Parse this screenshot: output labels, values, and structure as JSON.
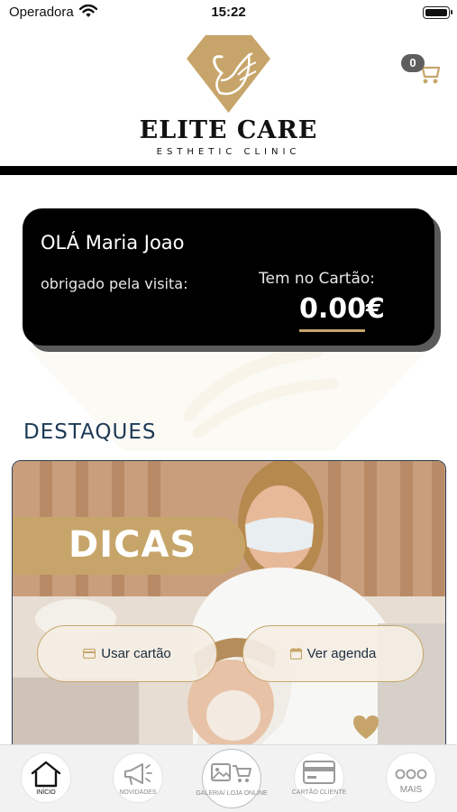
{
  "status_bar": {
    "carrier": "Operadora",
    "time": "15:22"
  },
  "brand": {
    "name": "ELITE CARE",
    "subtitle": "ESTHETIC CLINIC",
    "accent_color": "#c7a56a"
  },
  "cart": {
    "count": "0"
  },
  "greeting": {
    "hello": "OLÁ",
    "user_name": "Maria Joao",
    "thanks": "obrigado pela visita:",
    "balance_label": "Tem no Cartão:",
    "balance": "0.00€"
  },
  "highlights": {
    "title": "DESTAQUES",
    "banner_text": "DICAS",
    "use_card_label": "Usar cartão",
    "agenda_label": "Ver agenda"
  },
  "tabbar": {
    "home": "INÍCIO",
    "news": "NOVIDADES",
    "gallery": "GALERIA/ LOJA ONLINE",
    "client_card": "CARTÃO CLIENTE",
    "more": "MAIS"
  },
  "icons": {
    "wifi": "wifi-icon",
    "battery": "battery-icon",
    "cart": "cart-icon",
    "logo": "swan-diamond-logo",
    "home": "home-icon",
    "news": "megaphone-icon",
    "gallery": "image-cart-icon",
    "client_card": "credit-card-icon",
    "more": "dots-icon",
    "card_small": "credit-card-icon",
    "calendar_small": "calendar-icon",
    "heart": "heart-icon"
  }
}
